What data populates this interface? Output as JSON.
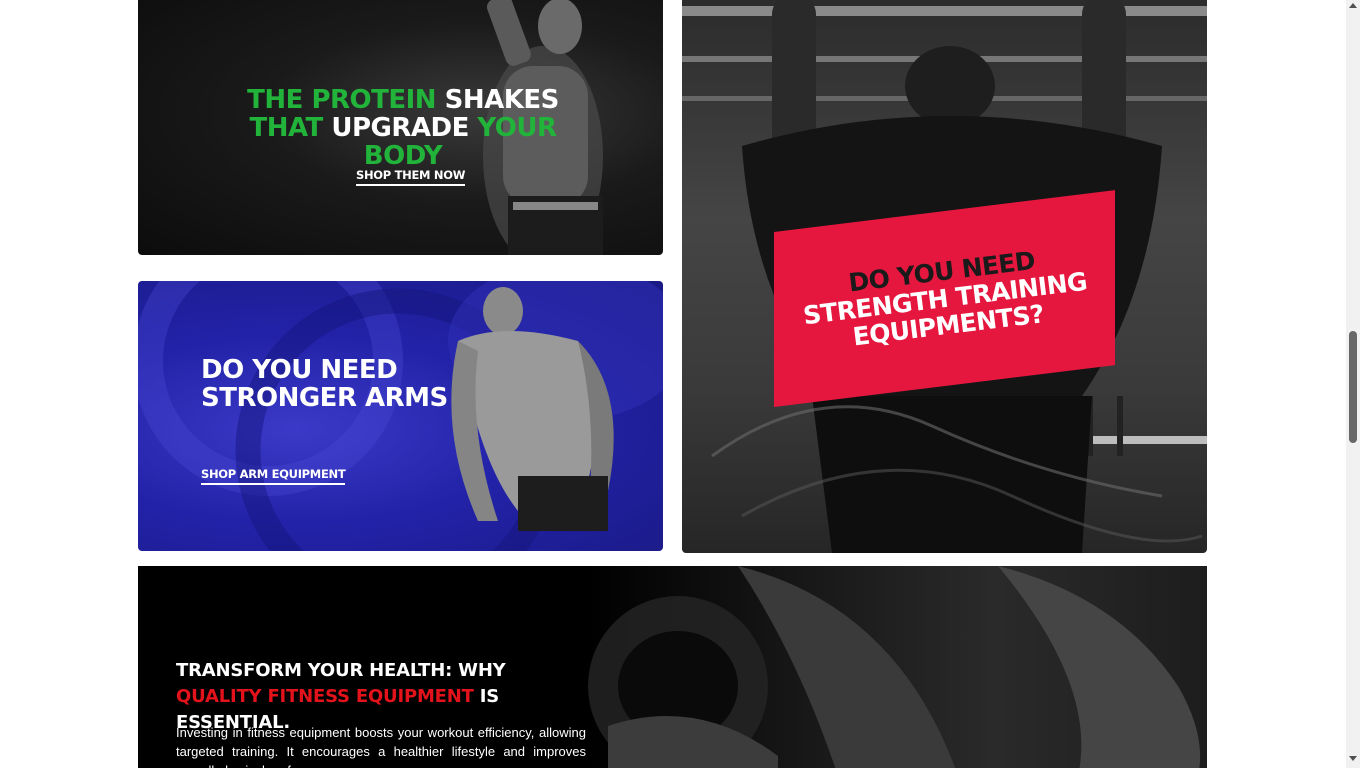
{
  "banners": {
    "protein": {
      "line1_green": "THE PROTEIN",
      "line1_white": " SHAKES",
      "line2_green": "THAT",
      "line2_white": " UPGRADE ",
      "line2_green_end": "YOUR BODY",
      "cta": "SHOP THEM NOW"
    },
    "arms": {
      "line1": "DO YOU NEED",
      "line2": "STRONGER ARMS",
      "cta": "SHOP ARM EQUIPMENT"
    },
    "strength": {
      "line1": "DO YOU NEED",
      "line2": "STRENGTH TRAINING",
      "line3": "EQUIPMENTS?"
    }
  },
  "transform": {
    "heading_white1": "TRANSFORM YOUR HEALTH: WHY ",
    "heading_red": "QUALITY FITNESS EQUIPMENT",
    "heading_white2": " IS ESSENTIAL.",
    "body": "Investing in fitness equipment boosts your workout efficiency, allowing targeted training. It encourages a healthier lifestyle and improves overall physical performance."
  },
  "colors": {
    "accent_green": "#22b33b",
    "accent_red": "#e3121b",
    "tag_pink": "#e5173f",
    "arms_blue": "#2222a8"
  },
  "icons": {
    "scroll_up": "triangle-up-icon",
    "scroll_down": "triangle-down-icon"
  }
}
